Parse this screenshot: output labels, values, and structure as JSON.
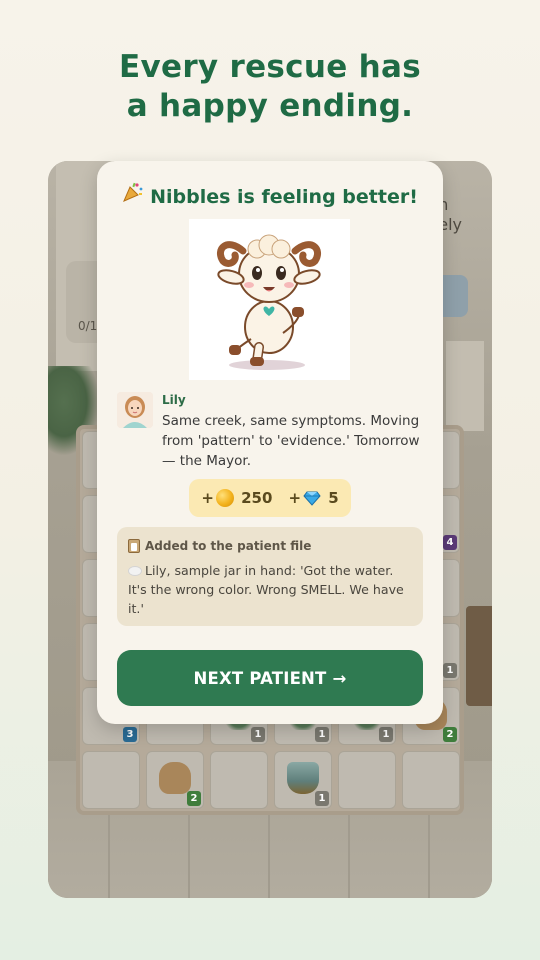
{
  "headline": {
    "line1": "Every rescue has",
    "line2": "a happy ending."
  },
  "background_game": {
    "left_counter": "0/1",
    "right_text_line1": "n",
    "right_text_line2": "ely",
    "cell_badges": [
      "4",
      "1",
      "3",
      "1",
      "1",
      "1",
      "2",
      "2",
      "1"
    ]
  },
  "modal": {
    "title": "Nibbles is feeling better!",
    "title_icon": "party-popper-icon",
    "pet_image": "goat-character",
    "speaker": {
      "name": "Lily",
      "avatar": "lily-avatar",
      "text": "Same creek, same symptoms. Moving from 'pattern' to 'evidence.' Tomorrow — the Mayor."
    },
    "rewards": {
      "coins": "+ 250",
      "coin_icon": "coin-icon",
      "gems": "+ 5",
      "gem_icon": "gem-icon"
    },
    "patient_file": {
      "heading": "Added to the patient file",
      "heading_icon": "clipboard-icon",
      "text": "Lily, sample jar in hand: 'Got the water. It's the wrong color. Wrong SMELL. We have it.'"
    },
    "next_button": "NEXT PATIENT →"
  },
  "colors": {
    "brand_green": "#1f6b45",
    "button_green": "#2f7a51",
    "reward_bg": "#fbe9b3",
    "file_bg": "#ece3cf"
  }
}
